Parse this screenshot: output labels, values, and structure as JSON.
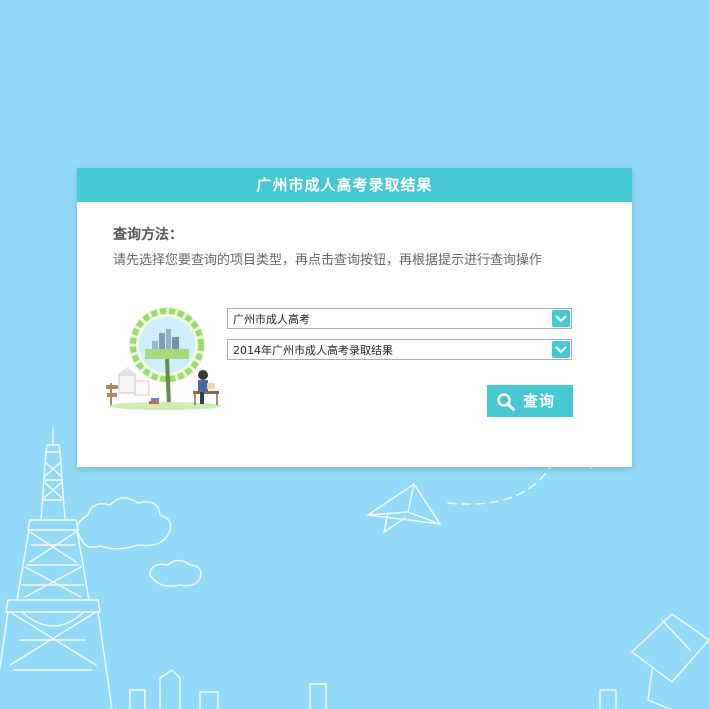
{
  "colors": {
    "background": "#92daf7",
    "accent": "#46c9d3",
    "panel": "#ffffff",
    "text_dark": "#555555",
    "text_body": "#666666"
  },
  "panel": {
    "title": "广州市成人高考录取结果",
    "method_title": "查询方法：",
    "method_desc": "请先选择您要查询的项目类型，再点击查询按钮，再根据提示进行查询操作"
  },
  "form": {
    "select_exam_type": "广州市成人高考",
    "select_result": "2014年广州市成人高考录取结果",
    "query_label": "查询"
  },
  "icons": {
    "select_arrow": "chevron-down-icon",
    "query": "search-icon"
  }
}
